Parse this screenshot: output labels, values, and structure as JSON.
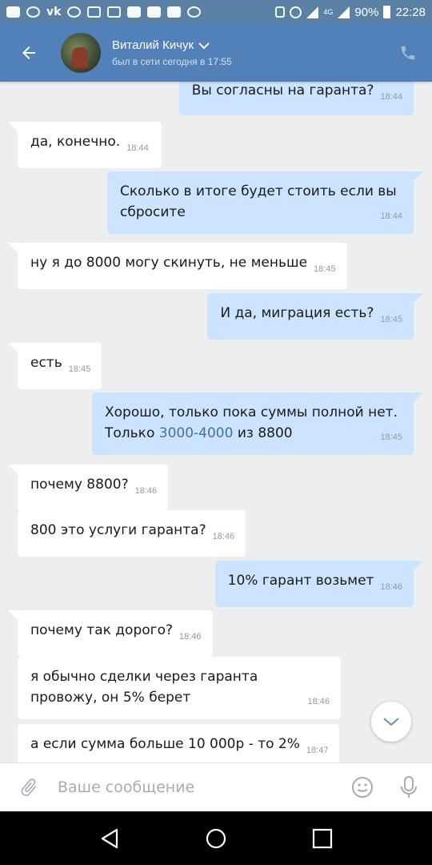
{
  "status_bar": {
    "vk_label": "vk",
    "battery": "90%",
    "time": "22:28",
    "network": "4G"
  },
  "header": {
    "name": "Виталий Кичук",
    "status": "был в сети сегодня в 17:55"
  },
  "messages": [
    {
      "dir": "out",
      "text": "Вы согласны на гаранта?",
      "time": "18:44"
    },
    {
      "dir": "in",
      "text": "да, конечно.",
      "time": "18:44"
    },
    {
      "dir": "out",
      "text": "Сколько в итоге будет стоить если вы сбросите",
      "time": "18:44"
    },
    {
      "dir": "in",
      "text": "ну я до 8000 могу скинуть, не меньше",
      "time": "18:45"
    },
    {
      "dir": "out",
      "text": "И да, миграция есть?",
      "time": "18:45"
    },
    {
      "dir": "in",
      "text": "есть",
      "time": "18:45"
    },
    {
      "dir": "out",
      "text_before": "Хорошо, только пока суммы полной нет. Только ",
      "link": "3000-4000",
      "text_after": " из 8800",
      "time": "18:45"
    },
    {
      "dir": "in",
      "text": "почему 8800?",
      "time": "18:46"
    },
    {
      "dir": "in",
      "text": "800 это услуги гаранта?",
      "time": "18:46"
    },
    {
      "dir": "out",
      "text": "10% гарант возьмет",
      "time": "18:46"
    },
    {
      "dir": "in",
      "text": "почему так дорого?",
      "time": "18:46"
    },
    {
      "dir": "in",
      "text": "я обычно сделки через гаранта провожу, он 5% берет",
      "time": "18:46"
    },
    {
      "dir": "in",
      "text": "а если сумма больше 10 000р - то 2%",
      "time": "18:47"
    }
  ],
  "composer": {
    "placeholder": "Ваше сообщение"
  },
  "icons": {
    "back": "arrow-left-icon",
    "call": "phone-icon",
    "dropdown": "chevron-down-icon",
    "attach": "paperclip-icon",
    "emoji": "smiley-icon",
    "mic": "microphone-icon",
    "scroll": "chevron-down-icon",
    "nav_back": "triangle-back-icon",
    "nav_home": "circle-home-icon",
    "nav_recent": "square-recent-icon"
  },
  "colors": {
    "header": "#5181b8",
    "statusbar": "#5b80a5",
    "outgoing_bubble": "#cce4ff",
    "incoming_bubble": "#ffffff",
    "chat_background": "#edeef0",
    "link": "#3f71a5"
  }
}
